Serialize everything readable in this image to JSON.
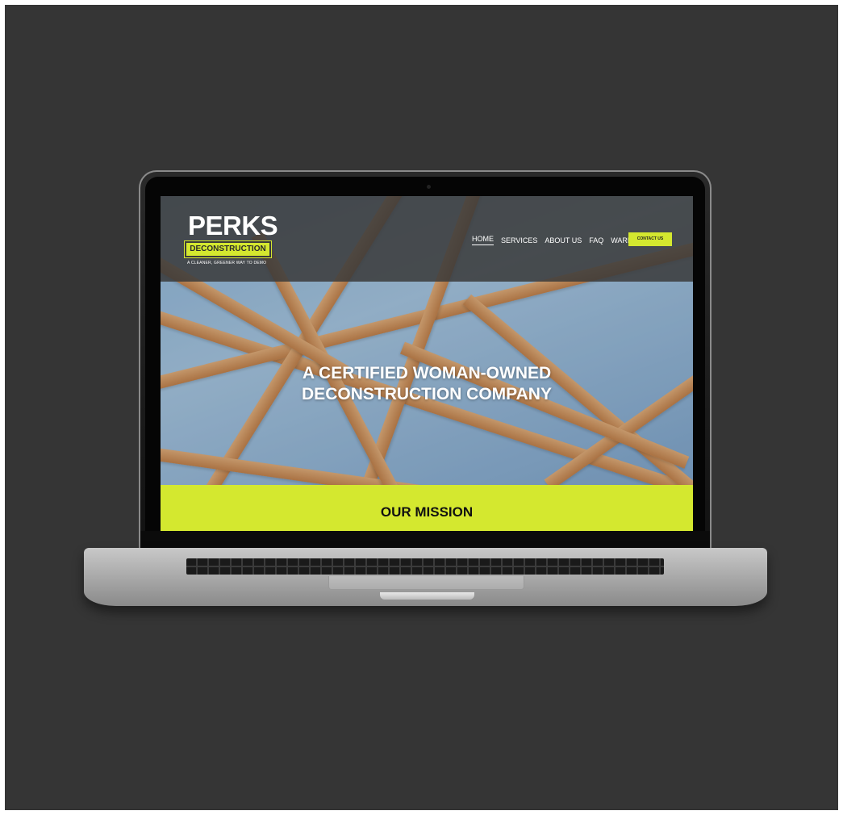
{
  "site": {
    "logo": {
      "name": "PERKS",
      "subname": "DECONSTRUCTION",
      "tagline": "A CLEANER, GREENER WAY TO DEMO"
    },
    "nav": {
      "items": [
        {
          "label": "HOME",
          "active": true
        },
        {
          "label": "SERVICES",
          "active": false
        },
        {
          "label": "ABOUT US",
          "active": false
        },
        {
          "label": "FAQ",
          "active": false
        },
        {
          "label": "WAREHOUSE",
          "active": false
        }
      ],
      "cta_label": "CONTACT US"
    },
    "hero": {
      "headline_line1": "A CERTIFIED WOMAN-OWNED",
      "headline_line2": "DECONSTRUCTION COMPANY"
    },
    "mission": {
      "title": "OUR MISSION"
    },
    "colors": {
      "accent": "#d4e82f",
      "header_bg": "#3a3a3a",
      "backdrop": "#353535"
    }
  }
}
